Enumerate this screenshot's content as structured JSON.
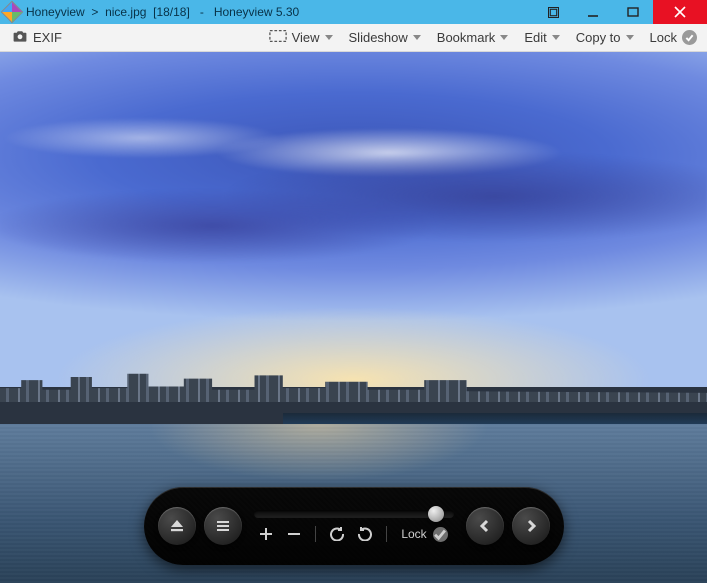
{
  "titlebar": {
    "app_name": "Honeyview",
    "separator": ">",
    "file_name": "nice.jpg",
    "index": "[18/18]",
    "dash": "-",
    "app_version": "Honeyview 5.30"
  },
  "toolbar": {
    "exif_label": "EXIF",
    "view_label": "View",
    "slideshow_label": "Slideshow",
    "bookmark_label": "Bookmark",
    "edit_label": "Edit",
    "copyto_label": "Copy to",
    "lock_label": "Lock"
  },
  "panel": {
    "lock_label": "Lock"
  }
}
